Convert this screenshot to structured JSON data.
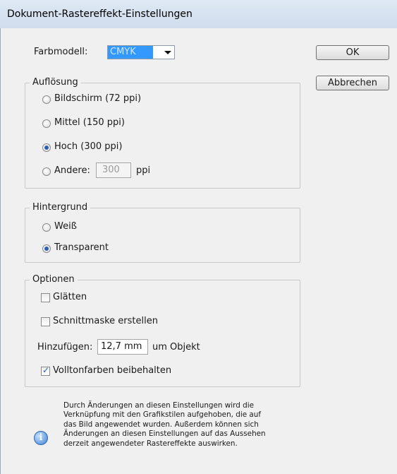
{
  "window": {
    "title": "Dokument-Rastereffekt-Einstellungen"
  },
  "color_model": {
    "label": "Farbmodell:",
    "value": "CMYK"
  },
  "buttons": {
    "ok": "OK",
    "cancel": "Abbrechen"
  },
  "resolution": {
    "legend": "Auflösung",
    "options": [
      {
        "label": "Bildschirm (72 ppi)",
        "selected": false
      },
      {
        "label": "Mittel (150 ppi)",
        "selected": false
      },
      {
        "label": "Hoch (300 ppi)",
        "selected": true
      },
      {
        "label": "Andere:",
        "selected": false
      }
    ],
    "other_value": "300",
    "other_unit": "ppi"
  },
  "background": {
    "legend": "Hintergrund",
    "options": [
      {
        "label": "Weiß",
        "selected": false
      },
      {
        "label": "Transparent",
        "selected": true
      }
    ]
  },
  "options": {
    "legend": "Optionen",
    "smooth": {
      "label": "Glätten",
      "checked": false
    },
    "clip_mask": {
      "label": "Schnittmaske erstellen",
      "checked": false
    },
    "add_label": "Hinzufügen:",
    "add_value": "12,7 mm",
    "add_suffix": "um Objekt",
    "spot_colors": {
      "label": "Volltonfarben beibehalten",
      "checked": true
    }
  },
  "info": {
    "lines": [
      "Durch Änderungen an diesen Einstellungen wird die",
      "Verknüpfung mit den Grafikstilen aufgehoben, die auf",
      "das Bild angewendet wurden. Außerdem können sich",
      "Änderungen an diesen Einstellungen auf das Aussehen",
      "derzeit angewendeter Rastereffekte auswirken."
    ]
  }
}
